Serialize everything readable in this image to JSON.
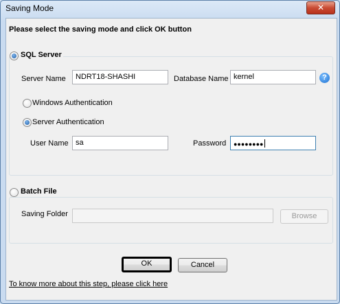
{
  "window": {
    "title": "Saving Mode",
    "close_label": "✕"
  },
  "heading": "Please select the saving mode and click OK button",
  "sql_server": {
    "label": "SQL Server",
    "server_name_label": "Server Name",
    "server_name_value": "NDRT18-SHASHI",
    "database_name_label": "Database Name",
    "database_name_value": "kernel",
    "help_glyph": "?",
    "windows_auth_label": "Windows Authentication",
    "server_auth_label": "Server Authentication",
    "user_name_label": "User Name",
    "user_name_value": "sa",
    "password_label": "Password",
    "password_mask": "●●●●●●●●"
  },
  "batch_file": {
    "label": "Batch File",
    "saving_folder_label": "Saving Folder",
    "saving_folder_value": "",
    "browse_label": "Browse"
  },
  "buttons": {
    "ok_label": "OK",
    "cancel_label": "Cancel"
  },
  "help_link": "To know more about this step, please click here",
  "icons": {
    "help": "help-icon",
    "close": "close-icon"
  }
}
